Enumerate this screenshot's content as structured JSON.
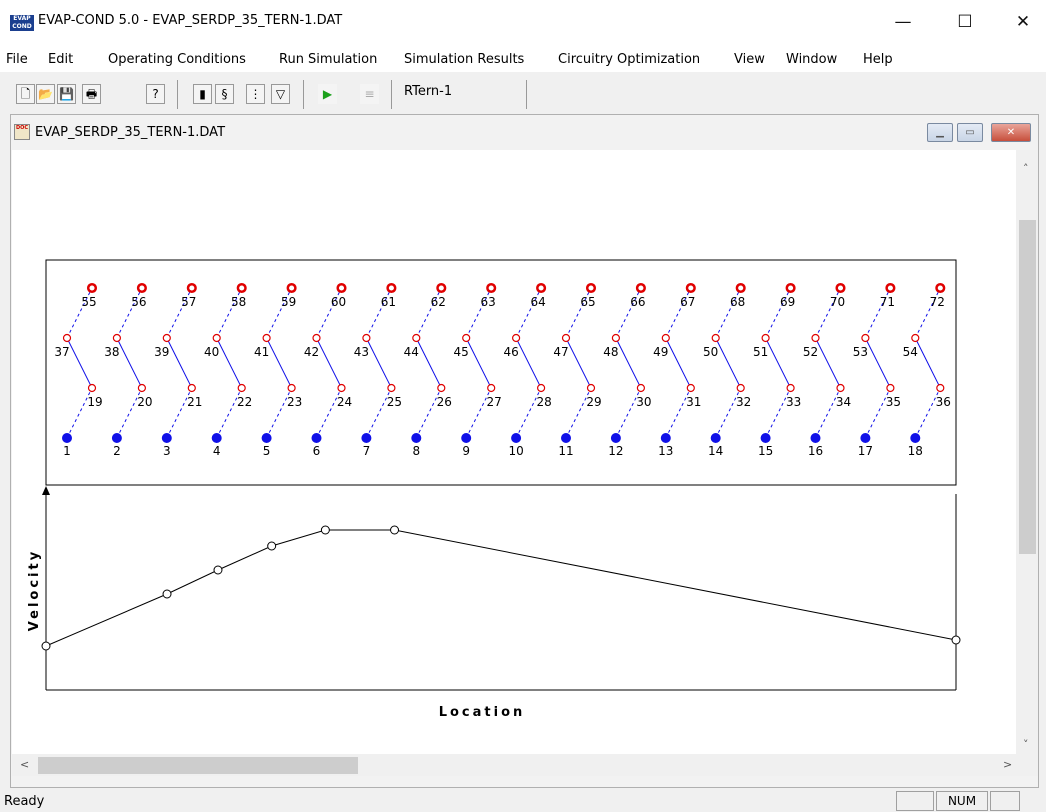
{
  "window": {
    "title": "EVAP-COND 5.0 - EVAP_SERDP_35_TERN-1.DAT",
    "logo_top": "EVAP",
    "logo_bottom": "COND",
    "minimize_glyph": "—",
    "maximize_glyph": "☐",
    "close_glyph": "✕"
  },
  "menu": [
    "File",
    "Edit",
    "Operating Conditions",
    "Run Simulation",
    "Simulation Results",
    "Circuitry Optimization",
    "View",
    "Window",
    "Help"
  ],
  "toolbar": {
    "label": "RTern-1",
    "buttons": [
      {
        "name": "new-file-icon",
        "glyph": "🗋"
      },
      {
        "name": "open-folder-icon",
        "glyph": "📂"
      },
      {
        "name": "save-disk-icon",
        "glyph": "💾"
      },
      {
        "name": "printer-icon",
        "glyph": "🖶"
      },
      {
        "name": "help-icon",
        "glyph": "?"
      },
      {
        "name": "refrigerant-can-icon",
        "glyph": "▮"
      },
      {
        "name": "coil-icon",
        "glyph": "§"
      },
      {
        "name": "circuit-icon",
        "glyph": "⋮"
      },
      {
        "name": "filter-icon",
        "glyph": "▽"
      },
      {
        "name": "run-play-icon",
        "glyph": "▶"
      },
      {
        "name": "report-icon",
        "glyph": "≡"
      }
    ]
  },
  "child_window": {
    "title": "EVAP_SERDP_35_TERN-1.DAT",
    "icon_text": "DOC",
    "minimize_glyph": "▁",
    "restore_glyph": "▭",
    "close_glyph": "✕"
  },
  "tube_diagram": {
    "row_bottom": [
      "1",
      "2",
      "3",
      "4",
      "5",
      "6",
      "7",
      "8",
      "9",
      "10",
      "11",
      "12",
      "13",
      "14",
      "15",
      "16",
      "17",
      "18"
    ],
    "row_lower_mid": [
      "19",
      "20",
      "21",
      "22",
      "23",
      "24",
      "25",
      "26",
      "27",
      "28",
      "29",
      "30",
      "31",
      "32",
      "33",
      "34",
      "35",
      "36"
    ],
    "row_upper_mid": [
      "37",
      "38",
      "39",
      "40",
      "41",
      "42",
      "43",
      "44",
      "45",
      "46",
      "47",
      "48",
      "49",
      "50",
      "51",
      "52",
      "53",
      "54"
    ],
    "row_top": [
      "55",
      "56",
      "57",
      "58",
      "59",
      "60",
      "61",
      "62",
      "63",
      "64",
      "65",
      "66",
      "67",
      "68",
      "69",
      "70",
      "71",
      "72"
    ],
    "inlet_color": "#1010e8",
    "outlet_color": "#e00000",
    "connector_color": "#1010e8"
  },
  "chart_data": {
    "type": "line",
    "xlabel": "Location",
    "ylabel": "Velocity",
    "x": [
      0.0,
      0.133,
      0.189,
      0.248,
      0.307,
      0.383,
      1.0
    ],
    "y": [
      0.22,
      0.48,
      0.6,
      0.72,
      0.8,
      0.8,
      0.25
    ],
    "xlim": [
      0,
      1
    ],
    "ylim": [
      0,
      1
    ],
    "grid": false,
    "series": [
      {
        "values": [
          0.22,
          0.48,
          0.6,
          0.72,
          0.8,
          0.8,
          0.25
        ]
      }
    ],
    "line_color": "#000000"
  },
  "scrollbars": {
    "up": "˄",
    "down": "˅",
    "left": "<",
    "right": ">"
  },
  "status": {
    "text": "Ready",
    "panel_num": "NUM",
    "panel_empty": ""
  }
}
